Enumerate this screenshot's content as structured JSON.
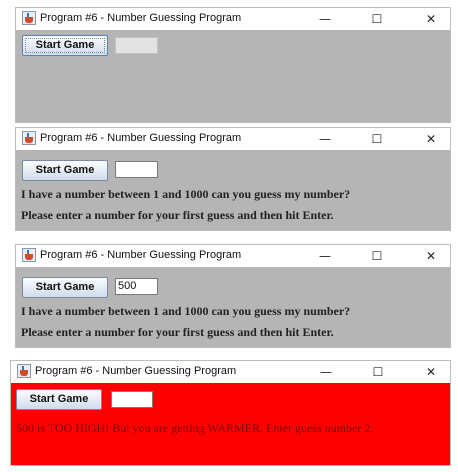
{
  "windows": [
    {
      "title": "Program #6 - Number Guessing Program",
      "start_button": "Start Game",
      "guess_value": "",
      "guess_enabled": false,
      "content_bg": "#b5b5b5",
      "messages": []
    },
    {
      "title": "Program #6 - Number Guessing Program",
      "start_button": "Start Game",
      "guess_value": "",
      "guess_enabled": true,
      "content_bg": "#b5b5b5",
      "messages": [
        "I have a number between 1 and 1000 can you guess my number?",
        "Please enter a number for your first guess and then hit Enter."
      ]
    },
    {
      "title": "Program #6 - Number Guessing Program",
      "start_button": "Start Game",
      "guess_value": "500",
      "guess_enabled": true,
      "content_bg": "#b5b5b5",
      "messages": [
        "I have a number between 1 and 1000 can you guess my number?",
        "Please enter a number for your first guess and then hit Enter."
      ]
    },
    {
      "title": "Program #6 - Number Guessing Program",
      "start_button": "Start Game",
      "guess_value": "",
      "guess_enabled": true,
      "content_bg": "#ff0000",
      "messages": [
        "500 is TOO HIGH!  But you are getting WARMER.  Enter guess number 2."
      ]
    }
  ],
  "window_controls": {
    "minimize": "—",
    "maximize": "☐",
    "close": "✕"
  }
}
